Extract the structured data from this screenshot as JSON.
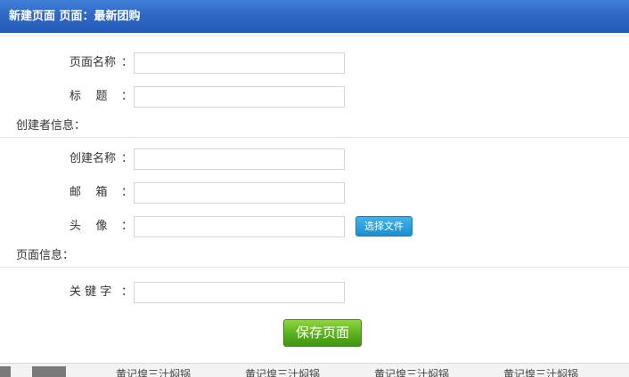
{
  "header": {
    "title": "新建页面 页面：最新团购"
  },
  "form": {
    "page_name": {
      "label": "页面名称",
      "colon": "：",
      "value": ""
    },
    "title": {
      "label": "标    题",
      "colon": "：",
      "value": ""
    },
    "creator_section": {
      "title": "创建者信息："
    },
    "creator_name": {
      "label": "创建名称",
      "colon": "：",
      "value": ""
    },
    "email": {
      "label": "邮    箱",
      "colon": "：",
      "value": ""
    },
    "avatar": {
      "label": "头    像",
      "colon": "：",
      "value": "",
      "button_label": "选择文件"
    },
    "page_info_section": {
      "title": "页面信息："
    },
    "keywords": {
      "label": "关 键 字",
      "colon": "：",
      "value": ""
    },
    "save_label": "保存页面"
  },
  "bottom_strip": {
    "items": [
      "黄记煌三汁焖锅",
      "黄记煌三汁焖锅",
      "黄记煌三汁焖锅",
      "黄记煌三汁焖锅"
    ]
  },
  "colors": {
    "header_blue": "#2f69c6",
    "file_button_blue": "#1c8fd1",
    "save_button_green": "#5ab01c"
  }
}
